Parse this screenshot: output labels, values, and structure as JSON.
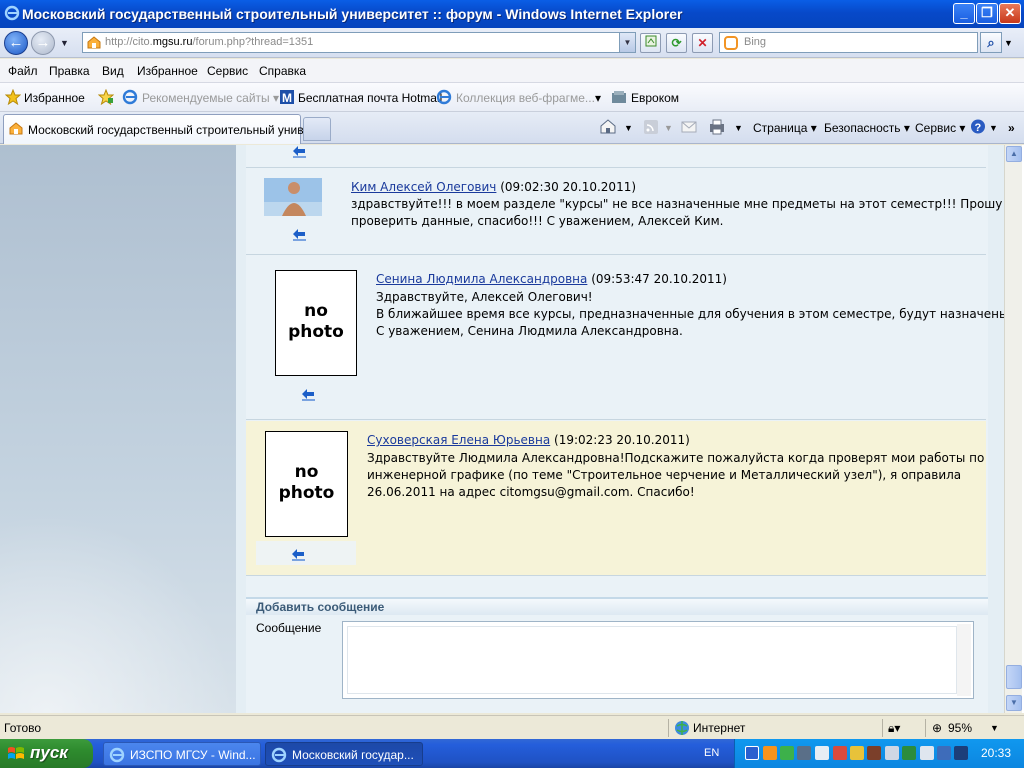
{
  "window": {
    "title": "Московский государственный строительный университет :: форум - Windows Internet Explorer",
    "min_label": "_",
    "max_label": "❐",
    "close_label": "✕"
  },
  "address": {
    "url_prefix": "http://cito.",
    "url_domain": "mgsu.ru",
    "url_path": "/forum.php?thread=1351",
    "search_placeholder": "Bing"
  },
  "menu": [
    "Файл",
    "Правка",
    "Вид",
    "Избранное",
    "Сервис",
    "Справка"
  ],
  "favorites": {
    "favorites_label": "Избранное",
    "items": [
      "Рекомендуемые сайты ▾",
      "Бесплатная почта Hotmail",
      "Коллекция веб-фрагме...",
      "Евроком"
    ]
  },
  "tab": {
    "active_label": "Московский государственный строительный унив...",
    "commands": [
      "Страница ▾",
      "Безопасность ▾",
      "Сервис ▾"
    ]
  },
  "posts": [
    {
      "author": "Ким Алексей Олегович",
      "timestamp": "(09:02:30 20.10.2011)",
      "lines": [
        "здравствуйте!!! в моем разделе \"курсы\" не все назначенные мне предметы на этот семестр!!! Прошу",
        "проверить данные, спасибо!!! С уважением, Алексей Ким."
      ]
    },
    {
      "author": "Сенина Людмила Александровна",
      "timestamp": "(09:53:47 20.10.2011)",
      "photo": "no photo",
      "lines": [
        "Здравствуйте, Алексей Олегович!",
        "В ближайшее время все курсы, предназначенные для обучения в этом семестре, будут назначены.",
        "С уважением, Сенина Людмила Александровна."
      ]
    },
    {
      "author": "Суховерская Елена Юрьевна",
      "timestamp": "(19:02:23 20.10.2011)",
      "photo": "no photo",
      "lines": [
        "Здравствуйте Людмила Александровна!Подскажите пожалуйста когда проверят мои работы по",
        "инженерной графике (по теме \"Строительное черчение и Металлический узел\"), я оправила",
        "26.06.2011 на адрес citomgsu@gmail.com. Спасибо!"
      ]
    }
  ],
  "add_message": {
    "header": "Добавить сообщение",
    "label": "Сообщение"
  },
  "status": {
    "text": "Готово",
    "zone": "Интернет",
    "zoom": "95%"
  },
  "taskbar": {
    "start": "пуск",
    "tasks": [
      "ИЗСПО МГСУ - Wind...",
      "Московский государ..."
    ],
    "lang": "EN",
    "clock": "20:33"
  }
}
